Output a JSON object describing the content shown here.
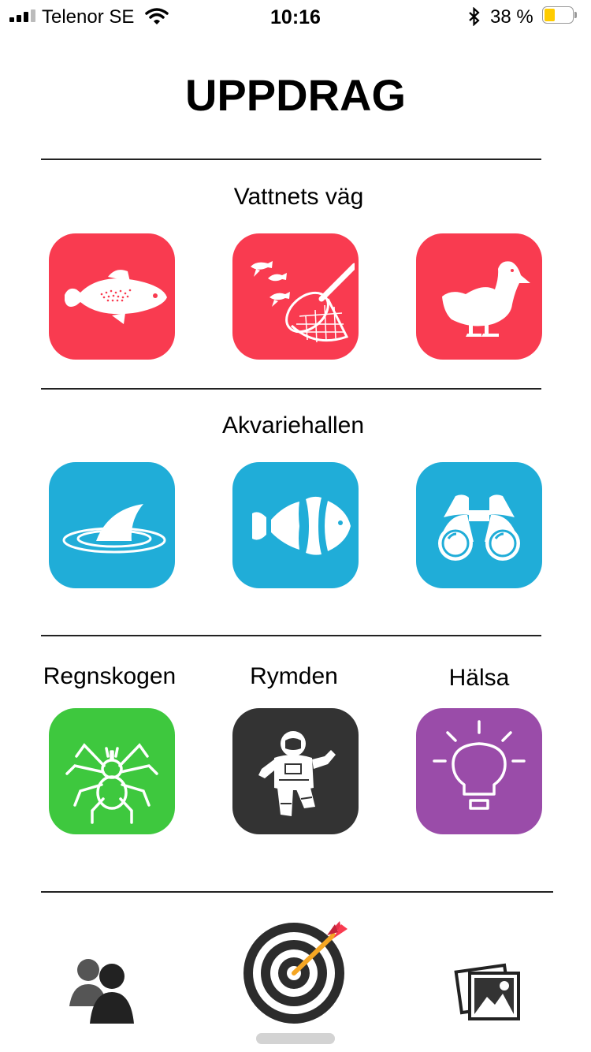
{
  "status_bar": {
    "carrier": "Telenor SE",
    "time": "10:16",
    "battery_percent": "38 %",
    "battery_level": 0.38,
    "signal_bars": 3
  },
  "header": {
    "title": "UPPDRAG"
  },
  "sections": [
    {
      "label": "Vattnets väg",
      "color": "#f93b50",
      "items": [
        {
          "icon": "fish-icon"
        },
        {
          "icon": "fishing-net-icon"
        },
        {
          "icon": "duck-icon"
        }
      ]
    },
    {
      "label": "Akvariehallen",
      "color": "#20add8",
      "items": [
        {
          "icon": "shark-fin-icon"
        },
        {
          "icon": "clownfish-icon"
        },
        {
          "icon": "binoculars-icon"
        }
      ]
    }
  ],
  "categories": [
    {
      "label": "Regnskogen",
      "icon": "spider-icon",
      "color": "#3ec83e"
    },
    {
      "label": "Rymden",
      "icon": "astronaut-icon",
      "color": "#333333"
    },
    {
      "label": "Hälsa",
      "icon": "lightbulb-icon",
      "color": "#9a4ca9"
    }
  ],
  "bottom_nav": [
    {
      "icon": "people-icon"
    },
    {
      "icon": "target-icon",
      "active": true
    },
    {
      "icon": "gallery-icon"
    }
  ]
}
